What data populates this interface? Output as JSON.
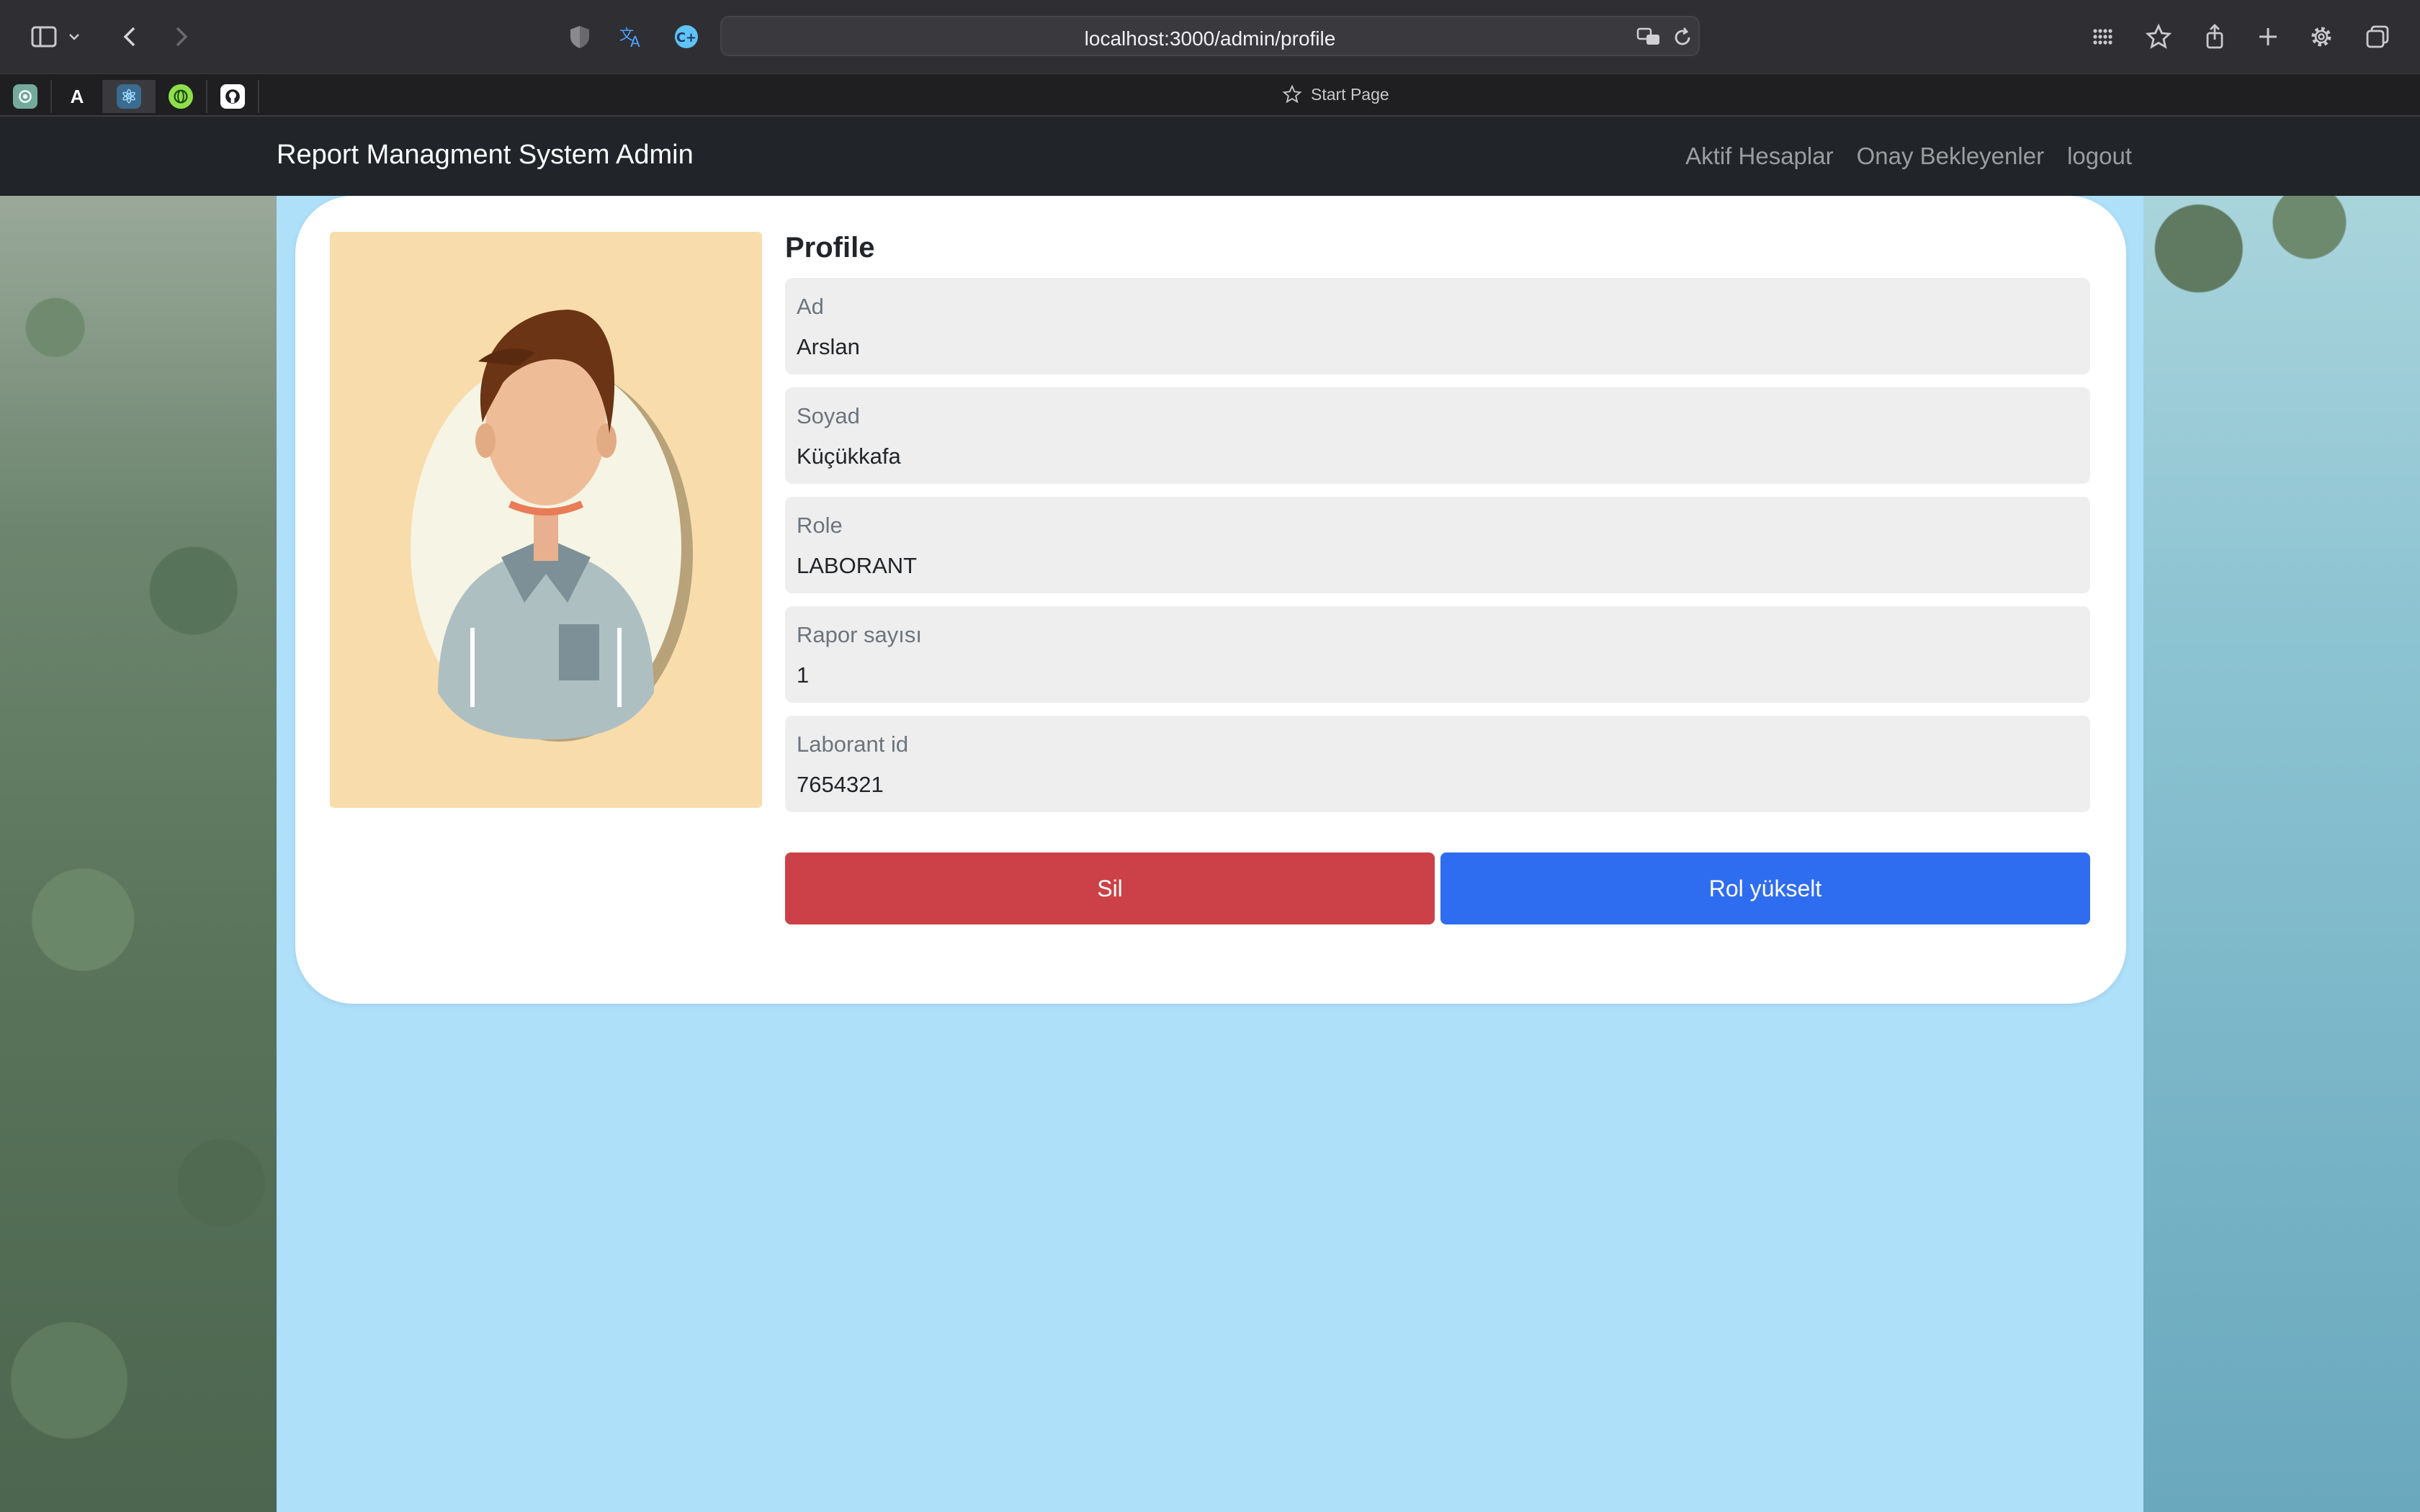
{
  "browser": {
    "url": "localhost:3000/admin/profile",
    "start_page_label": "Start Page",
    "favorites": [
      {
        "name": "chatgpt",
        "glyph": "",
        "color": "#74aa9c"
      },
      {
        "name": "font",
        "glyph": "A",
        "color": "#1f1f21"
      },
      {
        "name": "react",
        "glyph": "⚛",
        "color": "#3b6b8f"
      },
      {
        "name": "globe",
        "glyph": "",
        "color": "#8ee04a"
      },
      {
        "name": "github",
        "glyph": "",
        "color": "#ffffff"
      }
    ]
  },
  "navbar": {
    "brand": "Report Managment System Admin",
    "links": [
      "Aktif Hesaplar",
      "Onay Bekleyenler",
      "logout"
    ]
  },
  "profile": {
    "title": "Profile",
    "fields": [
      {
        "label": "Ad",
        "value": "Arslan"
      },
      {
        "label": "Soyad",
        "value": "Küçükkafa"
      },
      {
        "label": "Role",
        "value": "LABORANT"
      },
      {
        "label": "Rapor sayısı",
        "value": "1"
      },
      {
        "label": "Laborant id",
        "value": "7654321"
      }
    ],
    "delete_label": "Sil",
    "promote_label": "Rol yükselt"
  },
  "colors": {
    "delete": "#cc4147",
    "promote": "#2f6df0",
    "page_bg": "#aee0fa",
    "navbar": "#212529"
  }
}
